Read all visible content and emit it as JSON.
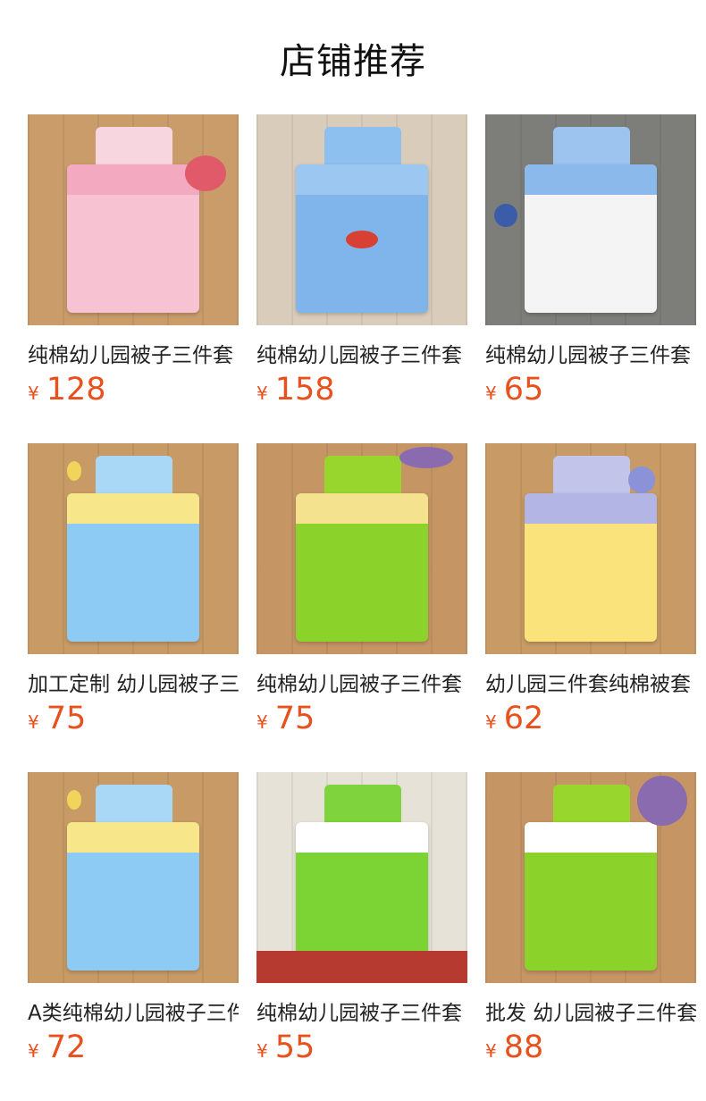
{
  "section": {
    "title": "店铺推荐"
  },
  "currency_symbol": "¥",
  "colors": {
    "price": "#e8501d"
  },
  "products": [
    {
      "title": "纯棉幼儿园被子三件套",
      "price": "128",
      "colors": {
        "bg": "#c99c6a",
        "quilt": "#f7c3d2",
        "fold": "#f3a9bf",
        "pillow": "#f7d6e0",
        "deco": "#e05a6a"
      }
    },
    {
      "title": "纯棉幼儿园被子三件套",
      "price": "158",
      "colors": {
        "bg": "#d9ccbb",
        "quilt": "#7fb5ea",
        "fold": "#9cc7f0",
        "pillow": "#8dbfef",
        "deco": "#d94034"
      }
    },
    {
      "title": "纯棉幼儿园被子三件套",
      "price": "65",
      "colors": {
        "bg": "#7d7d7a",
        "quilt": "#f4f4f4",
        "fold": "#8bb9ec",
        "pillow": "#9cc4ee",
        "deco": "#3b5ca8"
      }
    },
    {
      "title": "加工定制 幼儿园被子三件套",
      "price": "75",
      "colors": {
        "bg": "#c79a66",
        "quilt": "#8ecbf4",
        "fold": "#f8e68a",
        "pillow": "#a9d8f6",
        "deco": "#f1d45a"
      }
    },
    {
      "title": "纯棉幼儿园被子三件套",
      "price": "75",
      "colors": {
        "bg": "#c59564",
        "quilt": "#8bd32a",
        "fold": "#f5e28f",
        "pillow": "#98d62e",
        "deco": "#8a6bb0"
      }
    },
    {
      "title": "幼儿园三件套纯棉被套",
      "price": "62",
      "colors": {
        "bg": "#c79a66",
        "quilt": "#f9e37a",
        "fold": "#b3b6e5",
        "pillow": "#c3c4ea",
        "deco": "#8c92d8"
      }
    },
    {
      "title": "A类纯棉幼儿园被子三件套",
      "price": "72",
      "colors": {
        "bg": "#c79a66",
        "quilt": "#8ecbf4",
        "fold": "#f8e68a",
        "pillow": "#a9d8f6",
        "deco": "#f1d45a"
      }
    },
    {
      "title": "纯棉幼儿园被子三件套",
      "price": "55",
      "colors": {
        "bg": "#e7e2d8",
        "quilt": "#7cd334",
        "fold": "#ffffff",
        "pillow": "#7fd33c",
        "deco": "#d0903c"
      }
    },
    {
      "title": "批发 幼儿园被子三件套",
      "price": "88",
      "colors": {
        "bg": "#c59564",
        "quilt": "#8bd32a",
        "fold": "#ffffff",
        "pillow": "#98d62e",
        "deco": "#8a6bb0"
      }
    }
  ]
}
